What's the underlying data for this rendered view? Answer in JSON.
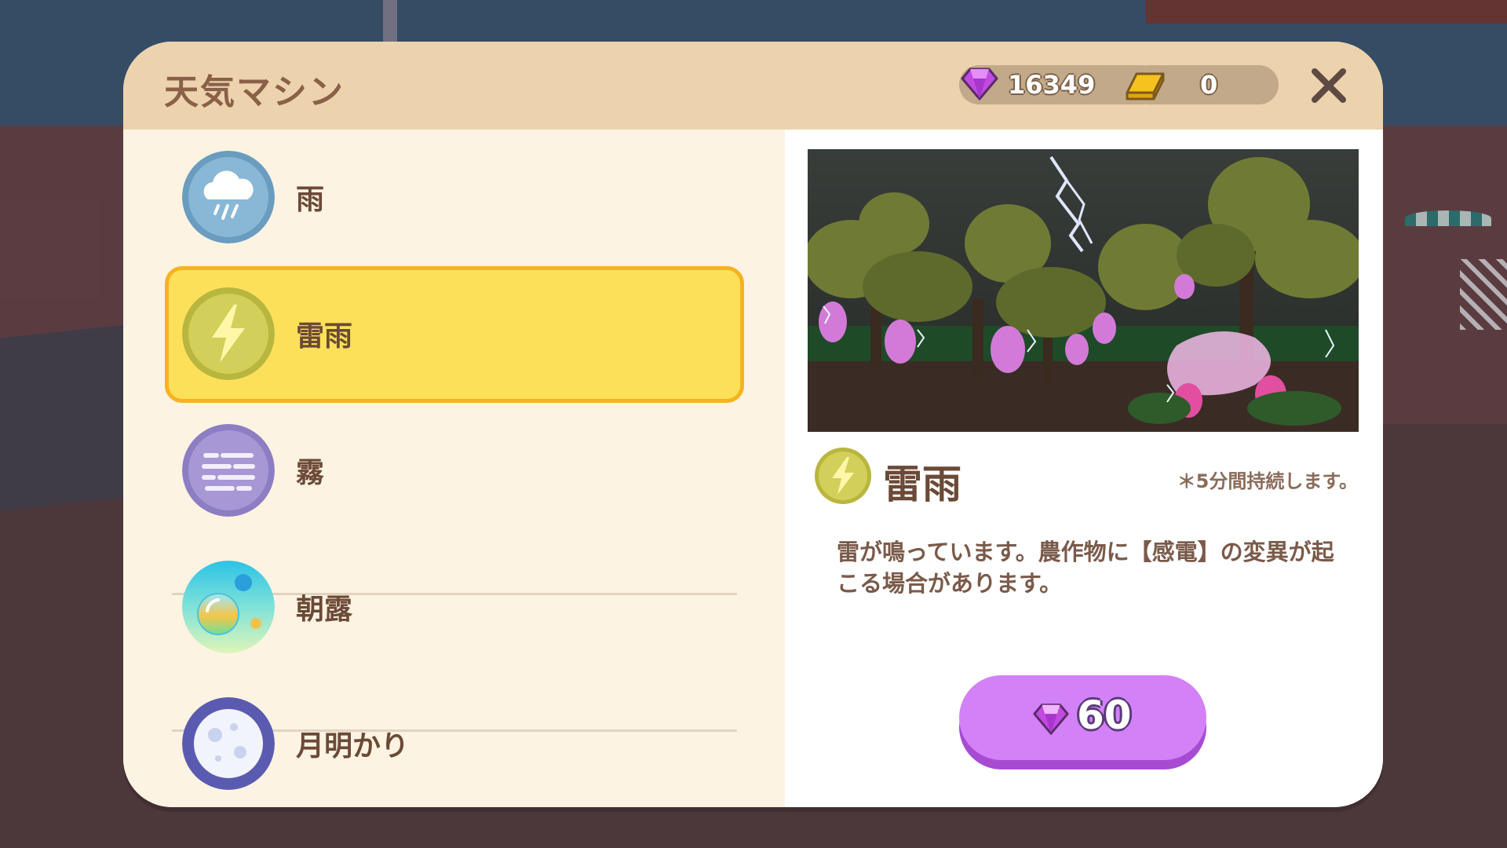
{
  "header": {
    "title": "天気マシン",
    "gems": "16349",
    "gold": "0"
  },
  "weather_list": [
    {
      "label": "雨",
      "icon": "rain-cloud-icon",
      "selected": false
    },
    {
      "label": "雷雨",
      "icon": "lightning-icon",
      "selected": true
    },
    {
      "label": "霧",
      "icon": "fog-icon",
      "selected": false
    },
    {
      "label": "朝露",
      "icon": "dew-drop-icon",
      "selected": false
    },
    {
      "label": "月明かり",
      "icon": "moon-icon",
      "selected": false
    }
  ],
  "detail": {
    "name": "雷雨",
    "duration_note": "＊5分間持続します。",
    "description": "雷が鳴っています。農作物に【感電】の変異が起こる場合があります。",
    "price": "60"
  },
  "colors": {
    "header_bg": "#ecd3ad",
    "panel_bg": "#fcf3e2",
    "selected_bg": "#fde05a",
    "selected_border": "#f6b21f",
    "buy_button": "#d381f6"
  }
}
